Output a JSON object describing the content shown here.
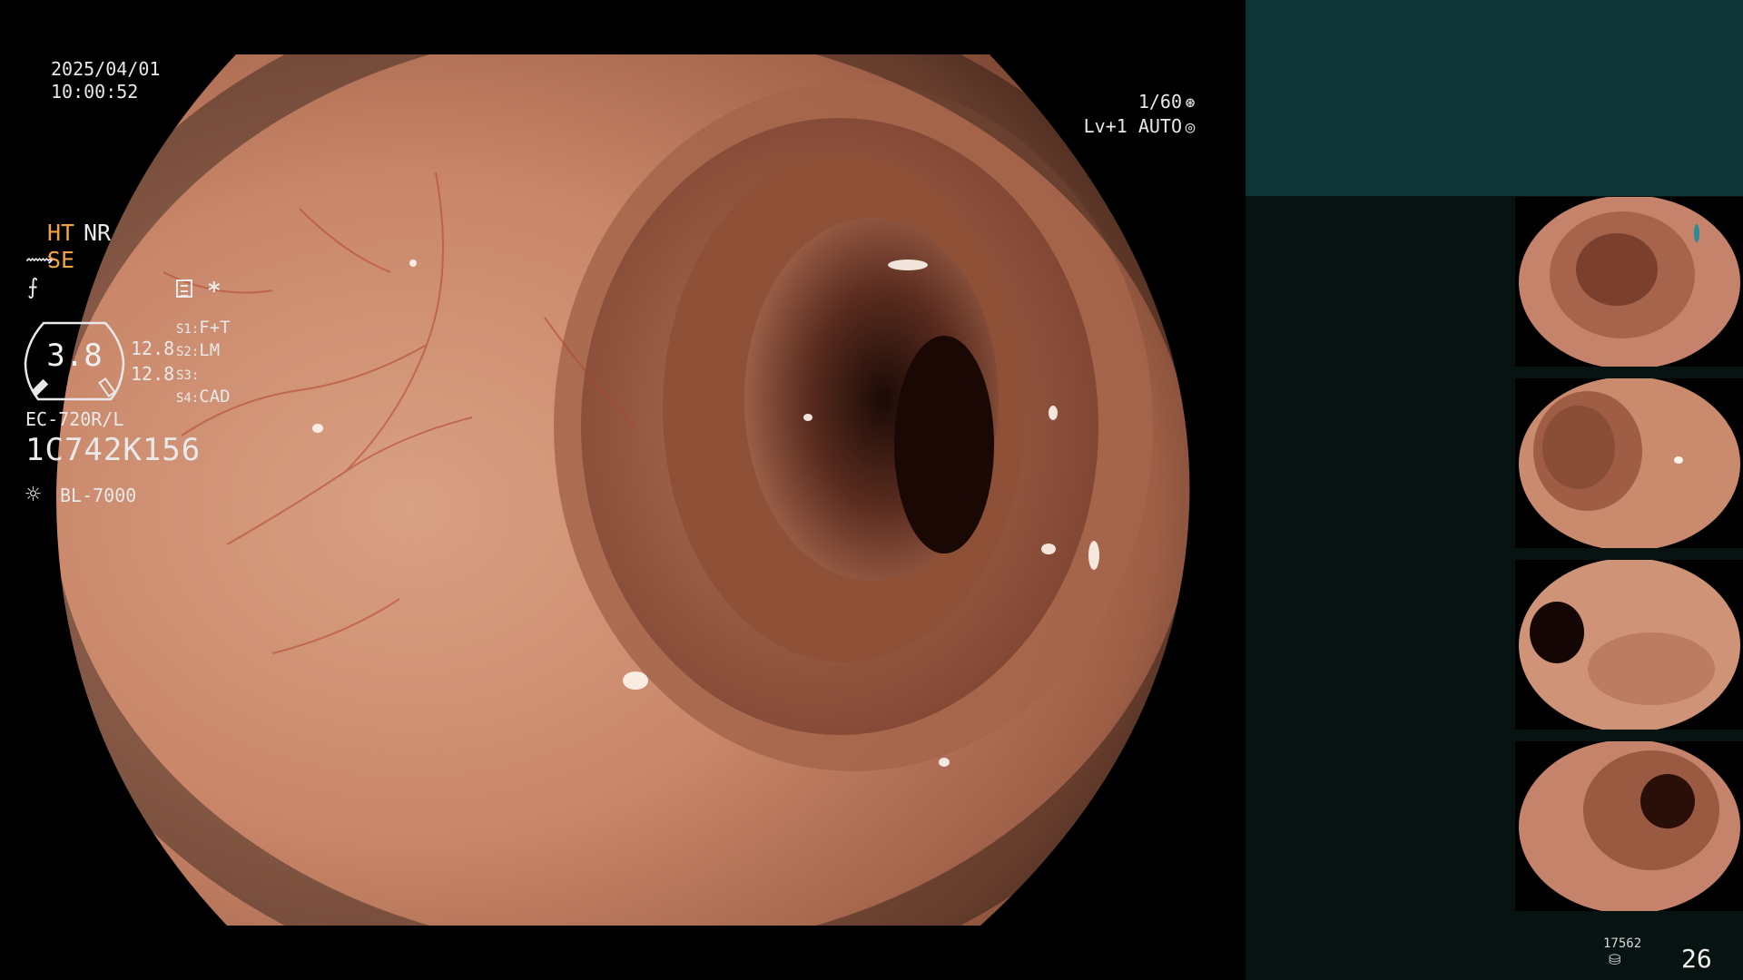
{
  "osd": {
    "date": "2025/04/01",
    "time": "10:00:52",
    "shutter": "1/60",
    "shutter_icon": "aperture-icon",
    "level": "Lv+1 AUTO",
    "level_icon": "iris-icon"
  },
  "panel": {
    "ht": "HT",
    "nr": "NR",
    "se": "SE",
    "se_icon": "structure-enhancement-icon",
    "fx_icon": "color-enhancement-icon",
    "settings_icon": "settings-list-icon",
    "asterisk": "*",
    "gauge_value": "3.8",
    "gauge_sub1": "12.8",
    "gauge_sub2": "12.8",
    "switches": [
      {
        "key": "S1:",
        "value": "F+T"
      },
      {
        "key": "S2:",
        "value": "LM"
      },
      {
        "key": "S3:",
        "value": ""
      },
      {
        "key": "S4:",
        "value": "CAD"
      }
    ],
    "scope_model": "EC-720R/L",
    "scope_serial": "1C742K156",
    "light_icon": "light-source-icon",
    "light_model": "BL-7000"
  },
  "footer": {
    "capture_count_small": "17562",
    "capture_count": "26",
    "storage_icon": "storage-icon"
  },
  "colors": {
    "accent_amber": "#f2a43c",
    "panel_top": "#0e3436",
    "panel_bg": "#071311",
    "mucosa": "#c98a6e"
  }
}
